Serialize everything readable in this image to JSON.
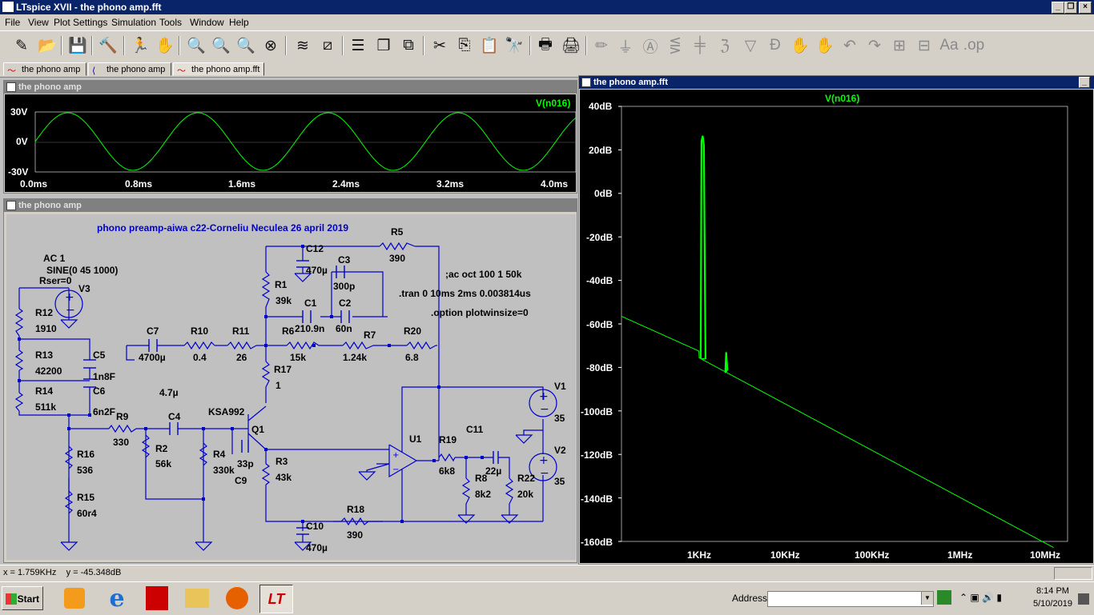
{
  "window": {
    "title": "LTspice XVII - the phono amp.fft",
    "minimize": "_",
    "restore": "❐",
    "close": "×"
  },
  "menu": [
    "File",
    "View",
    "Plot Settings",
    "Simulation",
    "Tools",
    "Window",
    "Help"
  ],
  "tabs": [
    "the phono amp",
    "the phono amp",
    "the phono amp.fft"
  ],
  "time_plot": {
    "header": "the phono amp",
    "trace": "V(n016)",
    "y_ticks": [
      "30V",
      "0V",
      "-30V"
    ],
    "x_ticks": [
      "0.0ms",
      "0.8ms",
      "1.6ms",
      "2.4ms",
      "3.2ms",
      "4.0ms"
    ],
    "color": "#00ff00"
  },
  "schematic": {
    "header": "the phono amp",
    "title": "phono preamp-aiwa c22-Corneliu Neculea 26 april 2019",
    "directives": [
      ";ac oct 100 1 50k",
      ".tran 0 10ms 2ms 0.003814us",
      ".option plotwinsize=0"
    ],
    "source_v3": [
      "AC 1",
      "SINE(0 45 1000)",
      "Rser=0"
    ],
    "labels": {
      "V3": "V3",
      "R12": "R12",
      "R12v": "1910",
      "R13": "R13",
      "R13v": "42200",
      "R14": "R14",
      "R14v": "511k",
      "C5": "C5",
      "C5v": "1n8F",
      "C6": "C6",
      "C6v": "6n2F",
      "R9": "R9",
      "R9v": "330",
      "C4": "C4",
      "C4v": "4.7µ",
      "R2": "R2",
      "R2v": "56k",
      "R4": "R4",
      "R4v": "330k",
      "R16": "R16",
      "R16v": "536",
      "R15": "R15",
      "R15v": "60r4",
      "C7": "C7",
      "C7v": "4700µ",
      "R10": "R10",
      "R10v": "0.4",
      "R11": "R11",
      "R11v": "26",
      "R6": "R6",
      "R6v": "15k",
      "R7": "R7",
      "R7v": "1.24k",
      "R20": "R20",
      "R20v": "6.8",
      "R17": "R17",
      "R17v": "1",
      "R1": "R1",
      "R1v": "39k",
      "C12": "C12",
      "C12v": "470µ",
      "C3": "C3",
      "C3v": "300p",
      "C1": "C1",
      "C1v": "210.9n",
      "C2": "C2",
      "C2v": "60n",
      "R5": "R5",
      "R5v": "390",
      "Q1type": "KSA992",
      "Q1": "Q1",
      "C9": "C9",
      "C9v": "33p",
      "R3": "R3",
      "R3v": "43k",
      "U1": "U1",
      "R19": "R19",
      "R19v": "6k8",
      "C11": "C11",
      "C11v": "22µ",
      "R8": "R8",
      "R8v": "8k2",
      "R22": "R22",
      "R22v": "20k",
      "V1": "V1",
      "V1v": "35",
      "V2": "V2",
      "V2v": "35",
      "R18": "R18",
      "R18v": "390",
      "C10": "C10",
      "C10v": "470µ"
    }
  },
  "fft_plot": {
    "header": "the phono amp.fft",
    "trace": "V(n016)",
    "y_ticks": [
      "40dB",
      "20dB",
      "0dB",
      "-20dB",
      "-40dB",
      "-60dB",
      "-80dB",
      "-100dB",
      "-120dB",
      "-140dB",
      "-160dB"
    ],
    "x_ticks": [
      "1KHz",
      "10KHz",
      "100KHz",
      "1MHz",
      "10MHz"
    ],
    "color": "#00ff00"
  },
  "status": {
    "cursor": "x = 1.759KHz    y = -45.348dB"
  },
  "taskbar": {
    "start": "Start",
    "address_label": "Address",
    "time": "8:14 PM",
    "date": "5/10/2019"
  }
}
